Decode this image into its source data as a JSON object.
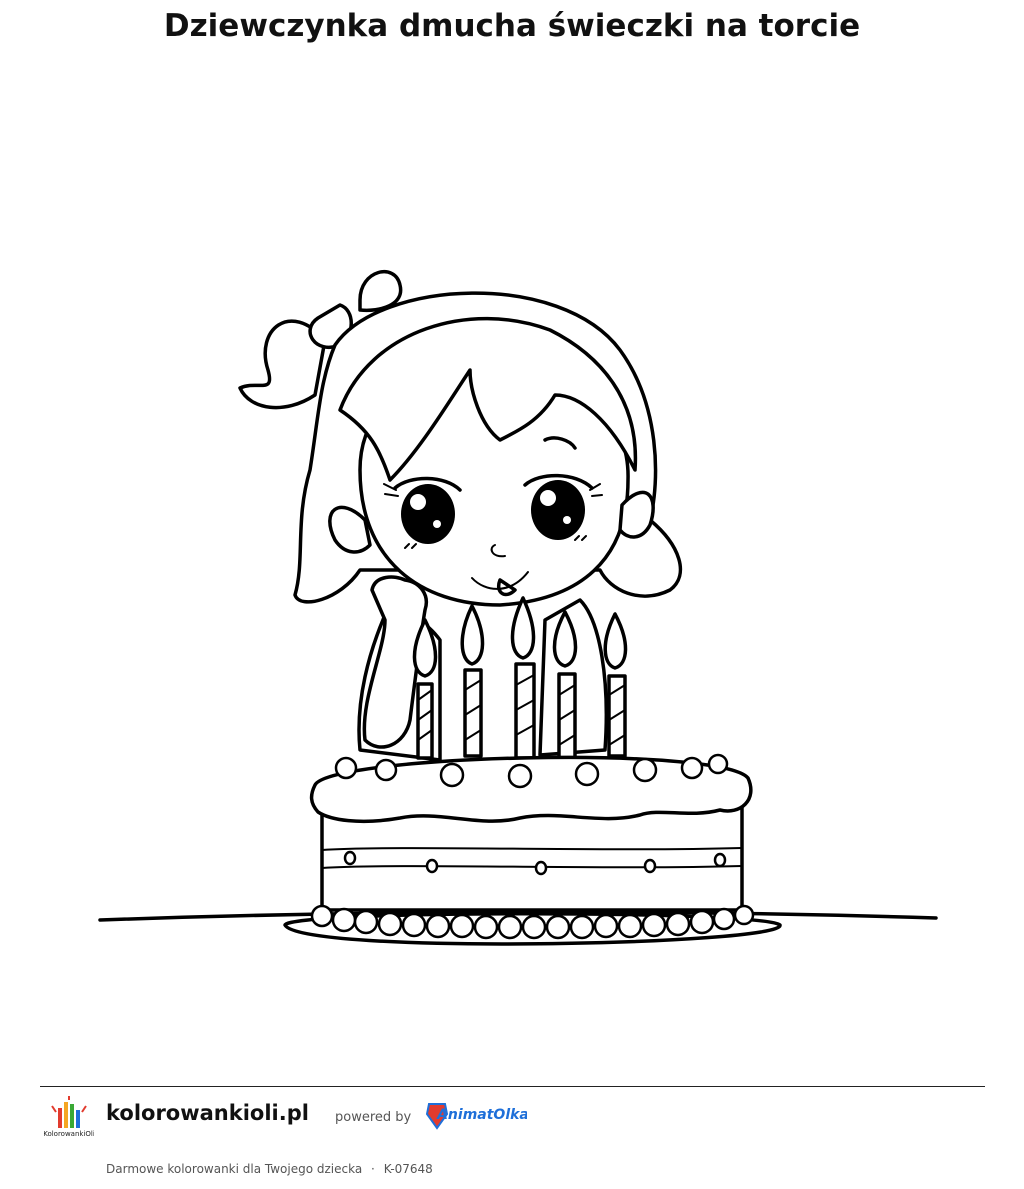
{
  "page": {
    "title": "Dziewczynka dmucha świeczki na torcie"
  },
  "illustration": {
    "subject": "girl-blowing-birthday-candles",
    "style": "black-outline-coloring-page"
  },
  "footer": {
    "site_name": "kolorowankioli.pl",
    "powered_by": "powered by",
    "logo_text": "KolorowankiOli",
    "partner_logo_text": "AnimatOlka",
    "tagline": "Darmowe kolorowanki dla Twojego dziecka",
    "separator": "·",
    "code": "K-07648"
  },
  "colors": {
    "text": "#111111",
    "muted": "#555555",
    "partner_blue": "#1e6fd9",
    "partner_red": "#e23b2e"
  }
}
